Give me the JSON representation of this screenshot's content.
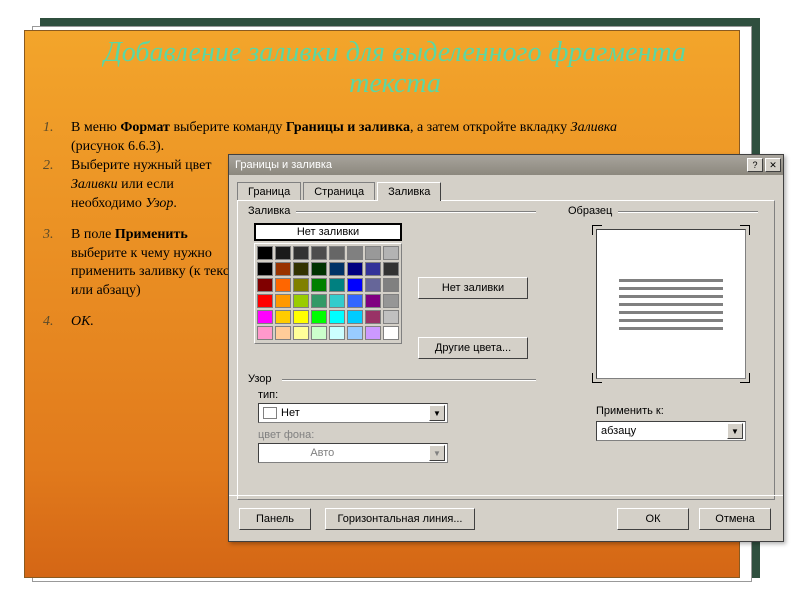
{
  "slide": {
    "title": "Добавление заливки для выделенного фрагмента текста",
    "step1_num": "1.",
    "step1_a": "В меню ",
    "step1_b": "Формат",
    "step1_c": " выберите команду ",
    "step1_d": "Границы и заливка",
    "step1_e": ", а затем откройте вкладку ",
    "step1_f": "Заливка",
    "step1_g": " (рисунок 6.6.3).",
    "step2_num": "2.",
    "step2_a": "Выберите нужный цвет ",
    "step2_b": "Заливки",
    "step2_c": " или если необходимо ",
    "step2_d": "Узор",
    "step2_e": ".",
    "step3_num": "3.",
    "step3_a": "В поле ",
    "step3_b": "Применить",
    "step3_c": " выберите к чему нужно применить заливку (к тексту или абзацу)",
    "step4_num": "4.",
    "step4_a": "ОК."
  },
  "dialog": {
    "title": "Границы и заливка",
    "tabs": {
      "t1": "Граница",
      "t2": "Страница",
      "t3": "Заливка"
    },
    "fill_group": "Заливка",
    "no_fill": "Нет заливки",
    "no_fill_right": "Нет заливки",
    "other_colors": "Другие цвета...",
    "pattern_group": "Узор",
    "type_label": "тип:",
    "type_value": "Нет",
    "bg_label": "цвет фона:",
    "bg_value": "Авто",
    "preview_group": "Образец",
    "apply_label": "Применить к:",
    "apply_value": "абзацу",
    "panel_btn": "Панель",
    "hr_btn": "Горизонтальная линия...",
    "ok": "ОК",
    "cancel": "Отмена",
    "palette": [
      "#000000",
      "#993300",
      "#333300",
      "#003300",
      "#003366",
      "#000080",
      "#333399",
      "#333333",
      "#800000",
      "#ff6600",
      "#808000",
      "#008000",
      "#008080",
      "#0000ff",
      "#666699",
      "#808080",
      "#ff0000",
      "#ff9900",
      "#99cc00",
      "#339966",
      "#33cccc",
      "#3366ff",
      "#800080",
      "#969696",
      "#ff00ff",
      "#ffcc00",
      "#ffff00",
      "#00ff00",
      "#00ffff",
      "#00ccff",
      "#993366",
      "#c0c0c0",
      "#ff99cc",
      "#ffcc99",
      "#ffff99",
      "#ccffcc",
      "#ccffff",
      "#99ccff",
      "#cc99ff",
      "#ffffff"
    ],
    "gray_row": [
      "#000000",
      "#1a1a1a",
      "#333333",
      "#4d4d4d",
      "#666666",
      "#808080",
      "#999999",
      "#b3b3b3"
    ]
  }
}
